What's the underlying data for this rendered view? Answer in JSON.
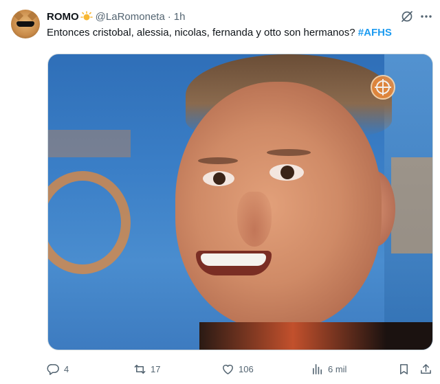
{
  "author": {
    "display_name": "ROMO",
    "handle": "@LaRomoneta",
    "separator": "·",
    "time": "1h",
    "badge_icon": "sun-emoji-icon"
  },
  "tweet": {
    "text": "Entonces cristobal, alessia, nicolas, fernanda y otto son hermanos? ",
    "hashtag": "#AFHS"
  },
  "header_icons": [
    "grok-icon",
    "more-options-icon"
  ],
  "media": {
    "description_icon": "tv-broadcaster-logo-icon"
  },
  "actions": {
    "replies": "4",
    "retweets": "17",
    "likes": "106",
    "views": "6 mil"
  },
  "colors": {
    "accent": "#1d9bf0",
    "muted": "#536471",
    "text": "#0f1419"
  }
}
